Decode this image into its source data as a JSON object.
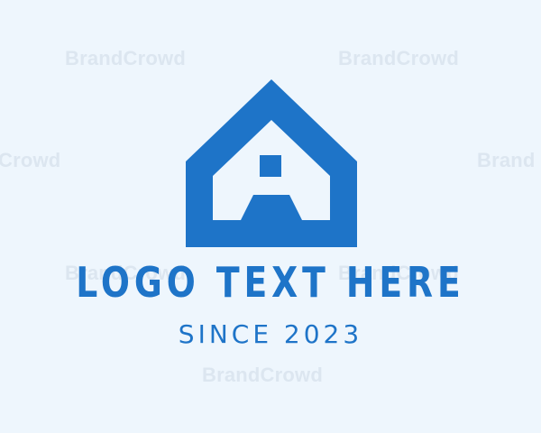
{
  "logo": {
    "icon": "house-icon",
    "brand_color": "#1E74C8",
    "background_color": "#EEF6FD",
    "text": "LOGO TEXT HERE",
    "slogan": "SINCE 2023"
  },
  "watermarks": [
    "BrandCrowd",
    "BrandCrowd",
    "Crowd",
    "Brand",
    "BrandCrowd",
    "BrandCrowd",
    "BrandCrowd"
  ]
}
